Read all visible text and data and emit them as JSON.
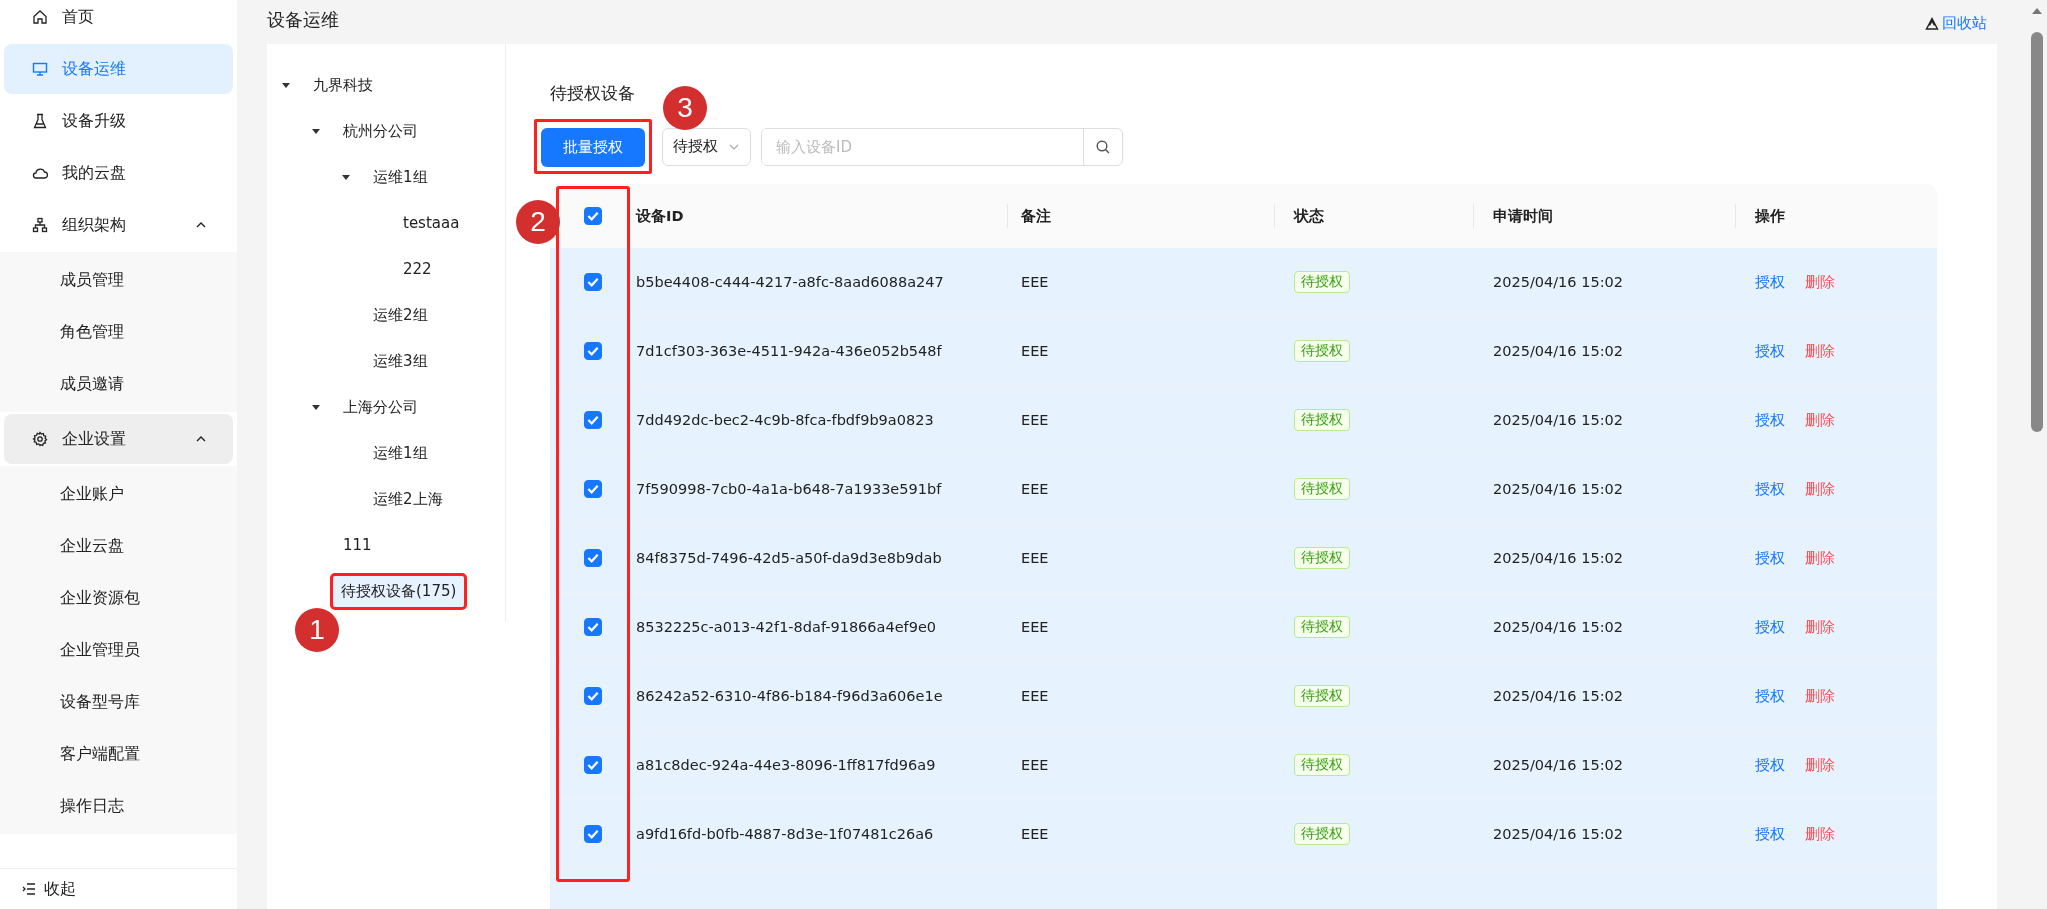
{
  "sidebar": {
    "items": [
      {
        "label": "首页",
        "selected": false
      },
      {
        "label": "设备运维",
        "selected": true
      },
      {
        "label": "设备升级",
        "selected": false
      },
      {
        "label": "我的云盘",
        "selected": false
      },
      {
        "label": "组织架构",
        "selected": false,
        "expanded": true,
        "children": [
          {
            "label": "成员管理",
            "selected": false
          },
          {
            "label": "角色管理",
            "selected": false
          },
          {
            "label": "成员邀请",
            "selected": false
          }
        ]
      },
      {
        "label": "企业设置",
        "selected": false,
        "highlighted": true,
        "expanded": true,
        "children": [
          {
            "label": "企业账户",
            "selected": false
          },
          {
            "label": "企业云盘",
            "selected": false
          },
          {
            "label": "企业资源包",
            "selected": false
          },
          {
            "label": "企业管理员",
            "selected": false
          },
          {
            "label": "设备型号库",
            "selected": false
          },
          {
            "label": "客户端配置",
            "selected": false
          },
          {
            "label": "操作日志",
            "selected": false
          }
        ]
      }
    ],
    "collapse_label": "收起"
  },
  "page": {
    "title": "设备运维",
    "recycle_link": "回收站"
  },
  "tree": [
    {
      "label": "九界科技",
      "expanded": true,
      "selected": false,
      "children": [
        {
          "label": "杭州分公司",
          "expanded": true,
          "selected": false,
          "children": [
            {
              "label": "运维1组",
              "expanded": true,
              "selected": false,
              "children": [
                {
                  "label": "testaaa",
                  "selected": false
                },
                {
                  "label": "222",
                  "selected": false
                }
              ]
            },
            {
              "label": "运维2组",
              "selected": false
            },
            {
              "label": "运维3组",
              "selected": false
            }
          ]
        },
        {
          "label": "上海分公司",
          "expanded": true,
          "selected": false,
          "children": [
            {
              "label": "运维1组",
              "selected": false
            },
            {
              "label": "运维2上海",
              "selected": false
            }
          ]
        },
        {
          "label": "111",
          "selected": false
        },
        {
          "label": "待授权设备(175)",
          "selected": true,
          "annotation": "1"
        }
      ]
    }
  ],
  "section_title": "待授权设备",
  "toolbar": {
    "batch_button": "批量授权",
    "batch_annotation": "3",
    "status_filter": "待授权",
    "search": {
      "placeholder": "输入设备ID"
    }
  },
  "table": {
    "select_all_checked": true,
    "checkbox_annotation": "2",
    "columns": [
      "设备ID",
      "备注",
      "状态",
      "申请时间",
      "操作"
    ],
    "rows": [
      {
        "checked": true,
        "id": "b5be4408-c444-4217-a8fc-8aad6088a247",
        "note": "EEE",
        "status": "待授权",
        "time": "2025/04/16 15:02",
        "actions": [
          {
            "label": "授权",
            "kind": "primary"
          },
          {
            "label": "删除",
            "kind": "danger"
          }
        ]
      },
      {
        "checked": true,
        "id": "7d1cf303-363e-4511-942a-436e052b548f",
        "note": "EEE",
        "status": "待授权",
        "time": "2025/04/16 15:02",
        "actions": [
          {
            "label": "授权",
            "kind": "primary"
          },
          {
            "label": "删除",
            "kind": "danger"
          }
        ]
      },
      {
        "checked": true,
        "id": "7dd492dc-bec2-4c9b-8fca-fbdf9b9a0823",
        "note": "EEE",
        "status": "待授权",
        "time": "2025/04/16 15:02",
        "actions": [
          {
            "label": "授权",
            "kind": "primary"
          },
          {
            "label": "删除",
            "kind": "danger"
          }
        ]
      },
      {
        "checked": true,
        "id": "7f590998-7cb0-4a1a-b648-7a1933e591bf",
        "note": "EEE",
        "status": "待授权",
        "time": "2025/04/16 15:02",
        "actions": [
          {
            "label": "授权",
            "kind": "primary"
          },
          {
            "label": "删除",
            "kind": "danger"
          }
        ]
      },
      {
        "checked": true,
        "id": "84f8375d-7496-42d5-a50f-da9d3e8b9dab",
        "note": "EEE",
        "status": "待授权",
        "time": "2025/04/16 15:02",
        "actions": [
          {
            "label": "授权",
            "kind": "primary"
          },
          {
            "label": "删除",
            "kind": "danger"
          }
        ]
      },
      {
        "checked": true,
        "id": "8532225c-a013-42f1-8daf-91866a4ef9e0",
        "note": "EEE",
        "status": "待授权",
        "time": "2025/04/16 15:02",
        "actions": [
          {
            "label": "授权",
            "kind": "primary"
          },
          {
            "label": "删除",
            "kind": "danger"
          }
        ]
      },
      {
        "checked": true,
        "id": "86242a52-6310-4f86-b184-f96d3a606e1e",
        "note": "EEE",
        "status": "待授权",
        "time": "2025/04/16 15:02",
        "actions": [
          {
            "label": "授权",
            "kind": "primary"
          },
          {
            "label": "删除",
            "kind": "danger"
          }
        ]
      },
      {
        "checked": true,
        "id": "a81c8dec-924a-44e3-8096-1ff817fd96a9",
        "note": "EEE",
        "status": "待授权",
        "time": "2025/04/16 15:02",
        "actions": [
          {
            "label": "授权",
            "kind": "primary"
          },
          {
            "label": "删除",
            "kind": "danger"
          }
        ]
      },
      {
        "checked": true,
        "id": "a9fd16fd-b0fb-4887-8d3e-1f07481c26a6",
        "note": "EEE",
        "status": "待授权",
        "time": "2025/04/16 15:02",
        "actions": [
          {
            "label": "授权",
            "kind": "primary"
          },
          {
            "label": "删除",
            "kind": "danger"
          }
        ]
      }
    ]
  }
}
